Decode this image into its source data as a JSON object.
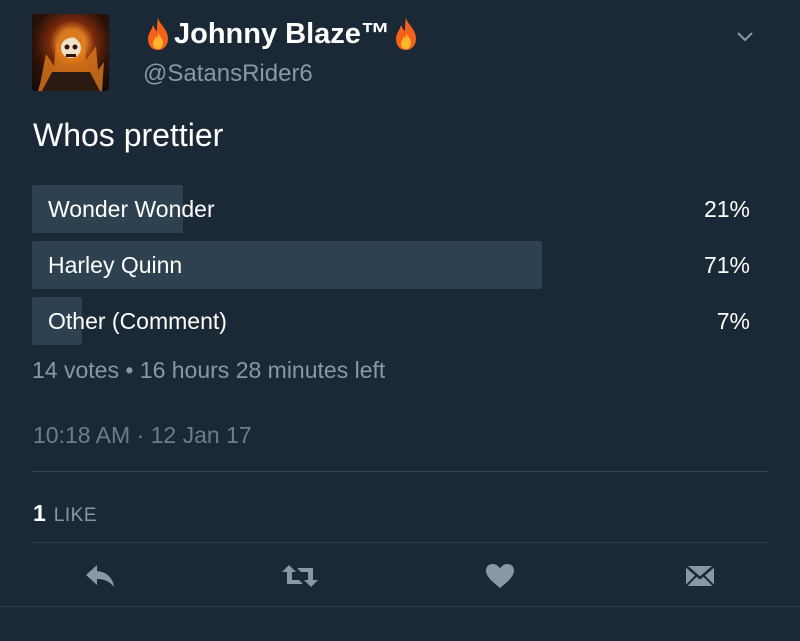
{
  "user": {
    "display_name": "Johnny Blaze™",
    "handle": "@SatansRider6",
    "name_emoji_icon": "fire-icon"
  },
  "tweet": {
    "text": "Whos prettier",
    "timestamp": "10:18 AM · 12 Jan 17"
  },
  "poll": {
    "options": [
      {
        "label": "Wonder Wonder",
        "percent_text": "21%",
        "percent": 21
      },
      {
        "label": "Harley Quinn",
        "percent_text": "71%",
        "percent": 71
      },
      {
        "label": "Other (Comment)",
        "percent_text": "7%",
        "percent": 7
      }
    ],
    "votes": "14 votes",
    "separator": "•",
    "time_left": "16 hours 28 minutes left"
  },
  "stats": {
    "likes_count": "1",
    "likes_label": "LIKE"
  },
  "actions": [
    "reply-icon",
    "retweet-icon",
    "heart-icon",
    "direct-message-icon"
  ],
  "colors": {
    "background": "#1b2836",
    "poll_bar": "#2e4150",
    "secondary_text": "#8899a6",
    "icon": "#8899a6",
    "divider": "#38444d"
  }
}
